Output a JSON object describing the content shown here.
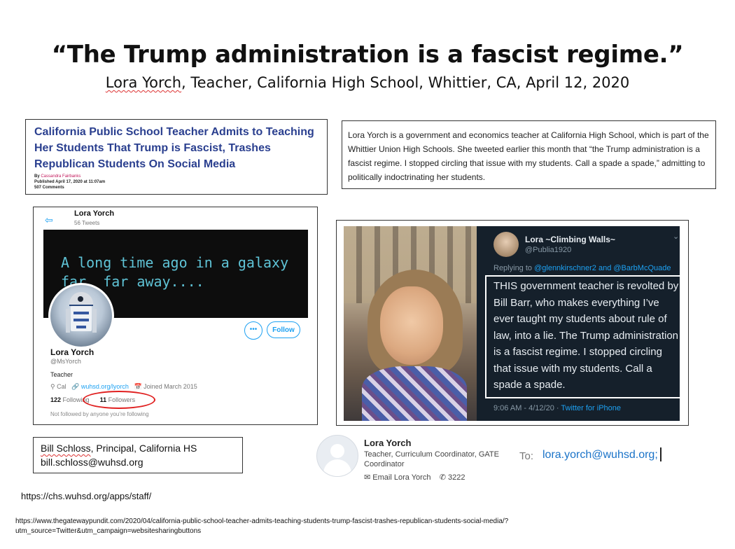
{
  "slide": {
    "title": "“The Trump administration is a fascist regime.”",
    "subtitle_name": "Lora Yorch",
    "subtitle_rest": ", Teacher, California High School, Whittier, CA, April 12, 2020"
  },
  "article": {
    "headline": "California Public School Teacher Admits to Teaching Her Students That Trump is Fascist, Trashes Republican Students On Social Media",
    "by_label": "By",
    "author": "Cassandra Fairbanks",
    "published": "Published April 17, 2020 at 11:07am",
    "comments": "507 Comments",
    "excerpt": "Lora Yorch is a government and economics teacher at California High School, which is part of the Whittier Union High Schools. She tweeted earlier this month that “the Trump administration is a fascist regime. I stopped circling that issue with my students. Call a spade a spade,” admitting to politically indoctrinating her students."
  },
  "profile": {
    "back_icon": "arrow-left-icon",
    "name_top": "Lora Yorch",
    "tweets_count": "56 Tweets",
    "banner_text": "A long time ago in a galaxy far, far away....",
    "more_label": "•••",
    "follow_label": "Follow",
    "name": "Lora Yorch",
    "handle": "@MsYorch",
    "bio": "Teacher",
    "location": "Cal",
    "website": "wuhsd.org/lyorch",
    "joined": "Joined March 2015",
    "following_count": "122",
    "following_label": "Following",
    "followers_count": "11",
    "followers_label": "Followers",
    "not_followed": "Not followed by anyone you’re following",
    "highlight_color": "#e02020"
  },
  "tweet": {
    "name": "Lora ~Climbing Walls~",
    "handle": "@Publia1920",
    "reply_prefix": "Replying to ",
    "reply_to": "@glennkirschner2 and @BarbMcQuade",
    "text": "THIS government teacher is revolted by Bill Barr, who makes everything I’ve ever taught my students about rule of law, into a lie. The Trump administration is a fascist regime. I stopped circling that issue with my students. Call a spade a spade.",
    "time": "9:06 AM - 4/12/20 · ",
    "source": "Twitter for iPhone"
  },
  "principal": {
    "line1_name": "Bill Schloss",
    "line1_rest": ", Principal, California HS",
    "email": "bill.schloss@wuhsd.org"
  },
  "staff": {
    "name": "Lora Yorch",
    "title": "Teacher, Curriculum Coordinator, GATE Coordinator",
    "email_label": "Email Lora Yorch",
    "phone": "3222",
    "to_label": "To:",
    "to_email": "lora.yorch@wuhsd.org;"
  },
  "sources": {
    "staff_url": "https://chs.wuhsd.org/apps/staff/",
    "article_url": "https://www.thegatewaypundit.com/2020/04/california-public-school-teacher-admits-teaching-students-trump-fascist-trashes-republican-students-social-media/?utm_source=Twitter&utm_campaign=websitesharingbuttons"
  }
}
